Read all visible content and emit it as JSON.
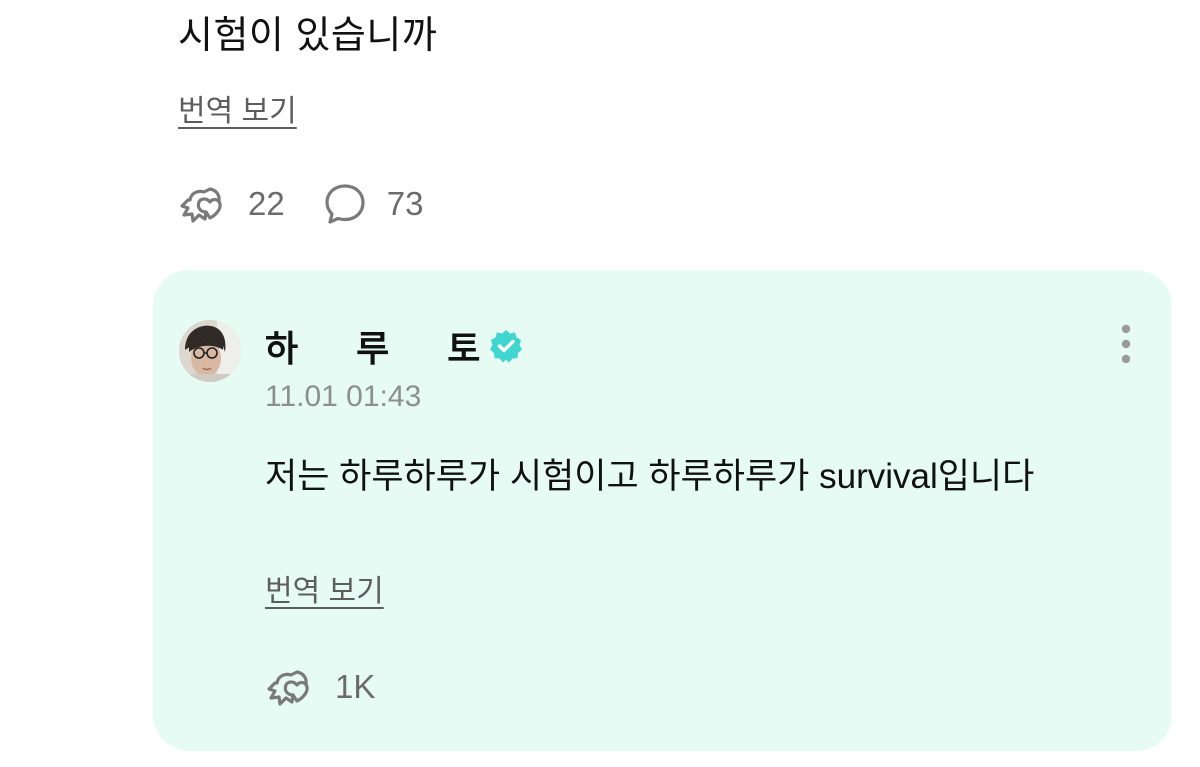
{
  "post": {
    "text": "시험이 있습니까",
    "translate_label": "번역 보기",
    "like_count": "22",
    "comment_count": "73",
    "like_icon": "hand-heart-icon",
    "comment_icon": "speech-bubble-icon"
  },
  "reply": {
    "author_name": "하루토",
    "verified_icon": "verified-badge-icon",
    "timestamp": "11.01 01:43",
    "text": "저는 하루하루가 시험이고 하루하루가 survival입니다",
    "translate_label": "번역 보기",
    "like_count": "1K",
    "more_icon": "more-vertical-icon"
  },
  "colors": {
    "card_background": "#e6fbf4",
    "verified_badge": "#3fd6d0",
    "muted_text": "#8e8e8e"
  }
}
